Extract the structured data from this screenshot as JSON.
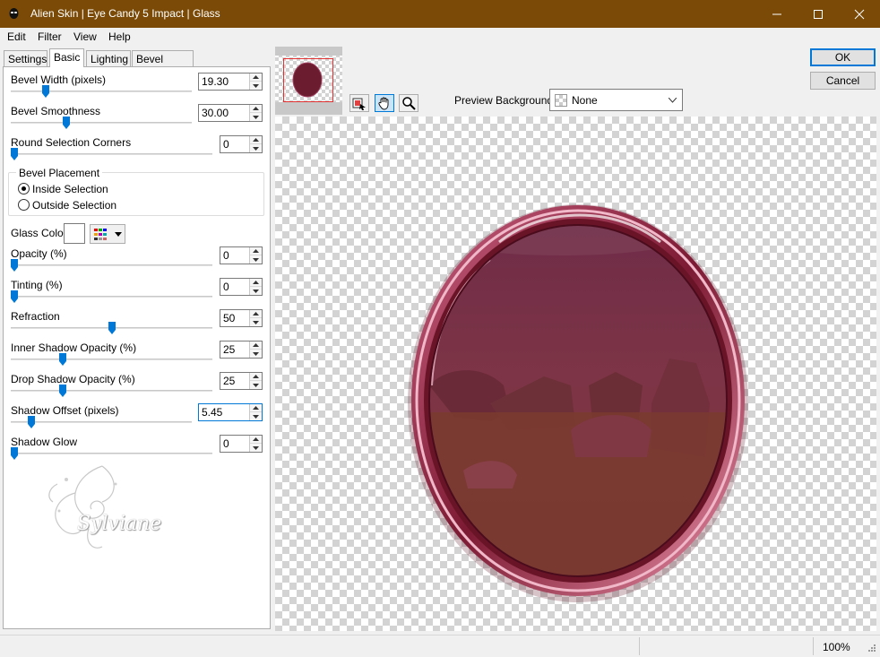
{
  "window": {
    "title": "Alien Skin | Eye Candy 5 Impact | Glass",
    "icon": "alien-head-icon",
    "controls": [
      "minimize-icon",
      "maximize-icon",
      "close-icon"
    ]
  },
  "menu": [
    "Edit",
    "Filter",
    "View",
    "Help"
  ],
  "tabs": [
    {
      "label": "Settings",
      "active": false
    },
    {
      "label": "Basic",
      "active": true
    },
    {
      "label": "Lighting",
      "active": false
    },
    {
      "label": "Bevel Profile",
      "active": false
    }
  ],
  "controls": {
    "bevel_width": {
      "label": "Bevel Width (pixels)",
      "value": "19.30",
      "slider_fraction": 0.18
    },
    "bevel_smoothness": {
      "label": "Bevel Smoothness",
      "value": "30.00",
      "slider_fraction": 0.3
    },
    "round_corners": {
      "label": "Round Selection Corners",
      "value": "0",
      "slider_fraction": 0.0
    },
    "bevel_placement": {
      "label": "Bevel Placement",
      "options": [
        {
          "label": "Inside Selection",
          "selected": true
        },
        {
          "label": "Outside Selection",
          "selected": false
        }
      ]
    },
    "glass_color": {
      "label": "Glass Color",
      "swatch": "#ffffff",
      "picker_icon": "color-palette-icon"
    },
    "opacity": {
      "label": "Opacity (%)",
      "value": "0",
      "slider_fraction": 0.0
    },
    "tinting": {
      "label": "Tinting (%)",
      "value": "0",
      "slider_fraction": 0.0
    },
    "refraction": {
      "label": "Refraction",
      "value": "50",
      "slider_fraction": 0.5
    },
    "inner_shadow_opacity": {
      "label": "Inner Shadow Opacity (%)",
      "value": "25",
      "slider_fraction": 0.25
    },
    "drop_shadow_opacity": {
      "label": "Drop Shadow Opacity (%)",
      "value": "25",
      "slider_fraction": 0.25
    },
    "shadow_offset": {
      "label": "Shadow Offset (pixels)",
      "value": "5.45",
      "slider_fraction": 0.1
    },
    "shadow_glow": {
      "label": "Shadow Glow",
      "value": "0",
      "slider_fraction": 0.0
    }
  },
  "watermark": "Sylviane",
  "toolbar": {
    "tools": [
      "navigate-preview-icon",
      "hand-tool-icon",
      "zoom-tool-icon"
    ],
    "preview_background_label": "Preview Background:",
    "preview_background_value": "None"
  },
  "buttons": {
    "ok": "OK",
    "cancel": "Cancel"
  },
  "status": {
    "zoom": "100%"
  },
  "colors": {
    "titlebar": "#7a4a06",
    "accent": "#0078d7",
    "frame": "#7d1a33",
    "glass": "#7a3040"
  }
}
